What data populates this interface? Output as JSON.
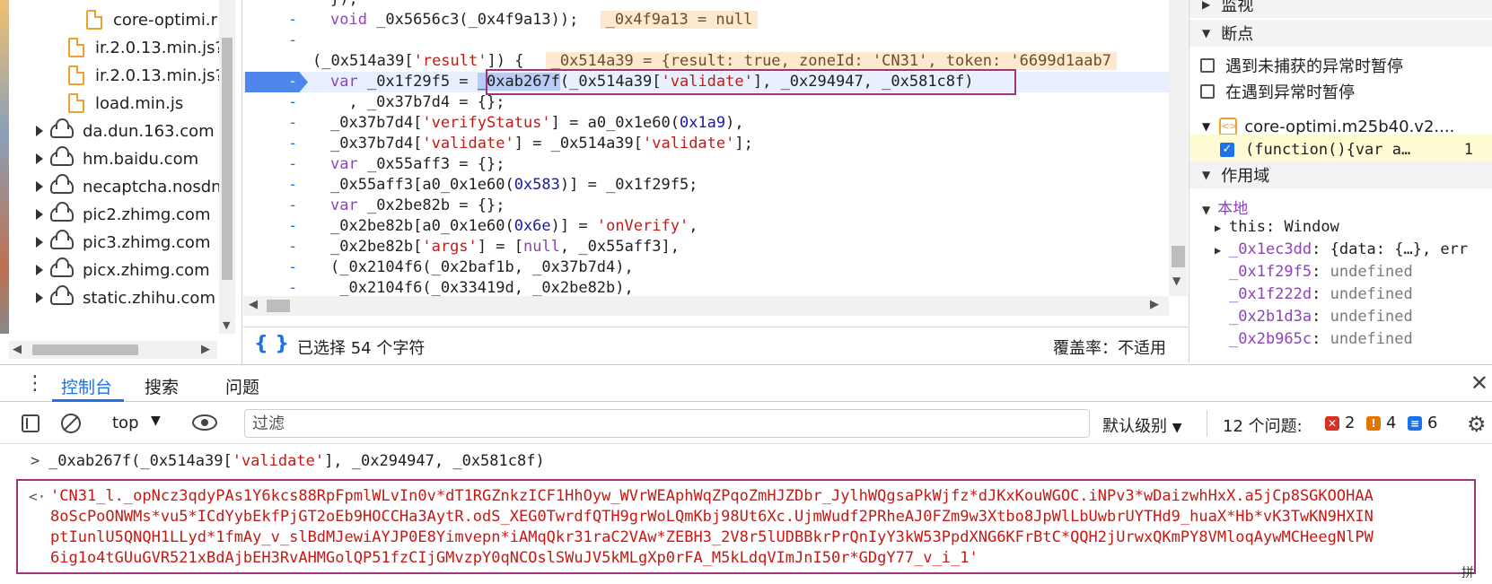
{
  "file_tree": {
    "items": [
      {
        "type": "file",
        "label": "core-optimi.r"
      },
      {
        "type": "file",
        "label": "ir.2.0.13.min.js?"
      },
      {
        "type": "file",
        "label": "ir.2.0.13.min.js?"
      },
      {
        "type": "file",
        "label": "load.min.js"
      },
      {
        "type": "domain",
        "label": "da.dun.163.com"
      },
      {
        "type": "domain",
        "label": "hm.baidu.com"
      },
      {
        "type": "domain",
        "label": "necaptcha.nosdn."
      },
      {
        "type": "domain",
        "label": "pic2.zhimg.com"
      },
      {
        "type": "domain",
        "label": "pic3.zhimg.com"
      },
      {
        "type": "domain",
        "label": "picx.zhimg.com"
      },
      {
        "type": "domain",
        "label": "static.zhihu.com"
      }
    ]
  },
  "editor": {
    "lines": [
      {
        "gutter": "",
        "html": "});"
      },
      {
        "gutter": "-",
        "html": "void _0x5656c3(_0x4f9a13)); <span class=\"inl\">_0x4f9a13 = null</span>",
        "kwfirst": "void"
      },
      {
        "gutter": "-",
        "html": ""
      },
      {
        "gutter": "",
        "html": "(_0x514a39[<span class=\"str\">'result'</span>]) { <span class=\"inl\">_0x514a39 = {result: true, zoneId: 'CN31', token: '6699d1aab7</span>"
      },
      {
        "gutter": "-",
        "html": "",
        "current": true
      },
      {
        "gutter": "-",
        "html": "  , _0x37b7d4 = {};"
      },
      {
        "gutter": "-",
        "html": "_0x37b7d4[<span class=\"str\">'verifyStatus'</span>] = a0_0x1e60(<span class=\"num\">0x1a9</span>),"
      },
      {
        "gutter": "-",
        "html": "_0x37b7d4[<span class=\"str\">'validate'</span>] = _0x514a39[<span class=\"str\">'validate'</span>];"
      },
      {
        "gutter": "-",
        "html": "<span class=\"kw\">var</span> _0x55aff3 = {};"
      },
      {
        "gutter": "-",
        "html": "_0x55aff3[a0_0x1e60(<span class=\"num\">0x583</span>)] = _0x1f29f5;"
      },
      {
        "gutter": "-",
        "html": "<span class=\"kw\">var</span> _0x2be82b = {};"
      },
      {
        "gutter": "-",
        "html": "_0x2be82b[a0_0x1e60(<span class=\"num\">0x6e</span>)] = <span class=\"str\">'onVerify'</span>,"
      },
      {
        "gutter": "-",
        "html": "_0x2be82b[<span class=\"str\">'args'</span>] = [<span class=\"kw\">null</span>, _0x55aff3],"
      },
      {
        "gutter": "-",
        "html": "(_0x2104f6(_0x2baf1b, _0x37b7d4),"
      },
      {
        "gutter": "-",
        "html": " _0x2104f6(_0x33419d, _0x2be82b),"
      }
    ],
    "current_line": {
      "prefix": "var _0x1f29f5 = ",
      "selected_fn": "_0xab267f",
      "rest_a": "(_0x514a39[",
      "rest_str": "'validate'",
      "rest_b": "], _0x294947, _0x581c8f)"
    },
    "status": {
      "selection": "已选择 54 个字符",
      "coverage": "覆盖率：不适用"
    }
  },
  "sidebar": {
    "watch_label": "监视",
    "breakpoints_label": "断点",
    "pause_uncaught": "遇到未捕获的异常时暂停",
    "pause_caught": "在遇到异常时暂停",
    "bp_file": "core-optimi.m25b40.v2....",
    "bp_code": "(function(){var a…",
    "bp_line": "1",
    "scope_label": "作用域",
    "local_label": "本地",
    "scope_items": [
      {
        "key": "this",
        "value": "Window",
        "expandable": true
      },
      {
        "key": "_0x1ec3dd",
        "value": "{data: {…}, err",
        "expandable": true
      },
      {
        "key": "_0x1f29f5",
        "value": "undefined",
        "expandable": false
      },
      {
        "key": "_0x1f222d",
        "value": "undefined",
        "expandable": false
      },
      {
        "key": "_0x2b1d3a",
        "value": "undefined",
        "expandable": false
      },
      {
        "key": "_0x2b965c",
        "value": "undefined",
        "expandable": false
      }
    ]
  },
  "drawer": {
    "tabs": [
      "控制台",
      "搜索",
      "问题"
    ],
    "active_tab": "控制台"
  },
  "console_toolbar": {
    "context": "top",
    "filter_placeholder": "过滤",
    "level": "默认级别",
    "issues_label": "12 个问题:",
    "errors": "2",
    "warnings": "4",
    "infos": "6",
    "error_color": "#d93025",
    "warning_color": "#e37400",
    "info_color": "#1a73e8"
  },
  "console": {
    "input": "_0xab267f(_0x514a39['validate'], _0x294947, _0x581c8f)",
    "output_lines": [
      "'CN31_l._opNcz3qdyPAs1Y6kcs88RpFpmlWLvIn0v*dT1RGZnkzICF1HhOyw_WVrWEAphWqZPqoZmHJZDbr_JylhWQgsaPkWjfz*dJKxKouWGOC.iNPv3*wDaizwhHxX.a5jCp8SGKOOHAA",
      "8oScPoONWMs*vu5*ICdYybEkfPjGT2oEb9HOCCHa3AytR.odS_XEG0TwrdfQTH9grWoLQmKbj98Ut6Xc.UjmWudf2PRheAJ0FZm9w3Xtbo8JpWlLbUwbrUYTHd9_huaX*Hb*vK3TwKN9HXIN",
      "ptIunlU5QNQH1LLyd*1fmAy_v_slBdMJewiAYJP0E8Yimvepn*iAMqQkr31raC2VAw*ZEBH3_2V8r5lUDBBkrPrQnIyY3kW53PpdXNG6KFrBtC*QQH2jUrwxQKmPY8VMloqAywMCHeegNlPW",
      "6ig1o4tGUuGVR521xBdAjbEH3RvAHMGolQP51fzCIjGMvzpY0qNCOslSWuJV5kMLgXp0rFA_M5kLdqVImJnI50r*GDgY77_v_i_1'"
    ]
  },
  "ime_indicator": "拼"
}
